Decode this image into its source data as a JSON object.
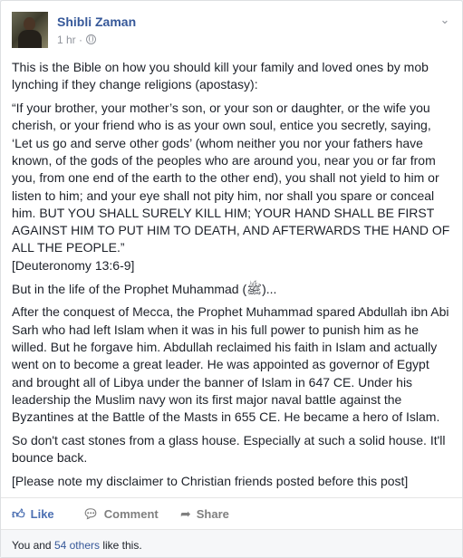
{
  "post": {
    "author": "Shibli Zaman",
    "timestamp": "1 hr",
    "separator": "·",
    "visibility_icon": "globe-icon",
    "options_icon": "chevron-down-icon",
    "paragraphs": [
      "This is the Bible on how you should kill your family and loved ones by mob lynching if they change religions (apostasy):",
      "“If your brother, your mother’s son, or your son or daughter, or the wife you cherish, or your friend who is as your own soul, entice you secretly, saying, ‘Let us go and serve other gods’ (whom neither you nor your fathers have known, of the gods of the peoples who are around you, near you or far from you, from one end of the earth to the other end), you shall not yield to him or listen to him; and your eye shall not pity him, nor shall you spare or conceal him. BUT YOU SHALL SURELY KILL HIM; YOUR HAND SHALL BE FIRST AGAINST HIM TO PUT HIM TO DEATH, AND AFTERWARDS THE HAND OF ALL THE PEOPLE.”",
      "[Deuteronomy 13:6-9]",
      "But in the life of the Prophet Muhammad (ﷺ)...",
      "After the conquest of Mecca, the Prophet Muhammad spared Abdullah ibn Abi Sarh who had left Islam when it was in his full power to punish him as he willed. But he forgave him. Abdullah reclaimed his faith in Islam and actually went on to become a great leader. He was appointed as governor of Egypt and brought all of Libya under the banner of Islam in 647 CE. Under his leadership the Muslim navy won its first major naval battle against the Byzantines at the Battle of the Masts in 655 CE. He became a hero of Islam.",
      "So don't cast stones from a glass house. Especially at such a solid house. It'll bounce back.",
      "[Please note my disclaimer to Christian friends posted before this post]"
    ]
  },
  "actions": {
    "like": "Like",
    "comment": "Comment",
    "share": "Share",
    "like_icon": "thumbs-up-icon",
    "comment_icon": "comment-icon",
    "share_icon": "share-arrow-icon"
  },
  "likes": {
    "prefix": "You and ",
    "others": "54 others",
    "suffix": " like this."
  },
  "colors": {
    "link": "#365899",
    "like_active": "#4b6fb2",
    "muted": "#90949c"
  }
}
